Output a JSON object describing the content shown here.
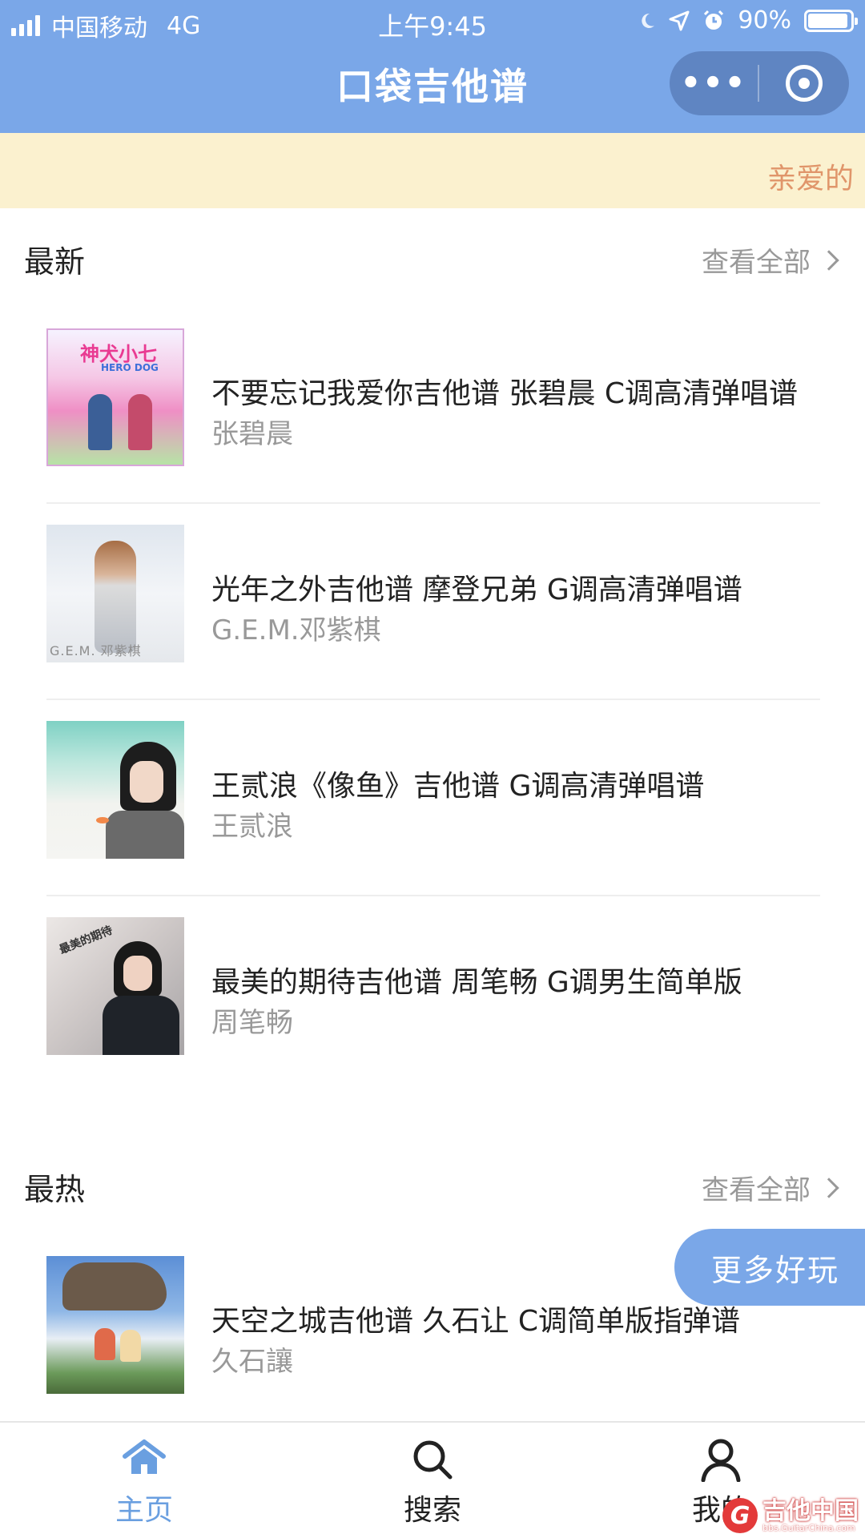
{
  "status_bar": {
    "carrier": "中国移动",
    "network": "4G",
    "time": "上午9:45",
    "battery": "90%",
    "battery_level": 0.9
  },
  "nav": {
    "title": "口袋吉他谱",
    "more_glyph": "•••"
  },
  "notice": {
    "text": "亲爱的"
  },
  "latest": {
    "title": "最新",
    "view_all": "查看全部",
    "items": [
      {
        "name": "不要忘记我爱你吉他谱 张碧晨 C调高清弹唱谱",
        "artist": "张碧晨"
      },
      {
        "name": "光年之外吉他谱 摩登兄弟 G调高清弹唱谱",
        "artist": "G.E.M.邓紫棋"
      },
      {
        "name": "王贰浪《像鱼》吉他谱 G调高清弹唱谱",
        "artist": "王贰浪"
      },
      {
        "name": "最美的期待吉他谱 周笔畅 G调男生简单版",
        "artist": "周笔畅"
      }
    ]
  },
  "hottest": {
    "title": "最热",
    "view_all": "查看全部",
    "items": [
      {
        "name": "天空之城吉他谱 久石让 C调简单版指弹谱",
        "artist": "久石讓"
      }
    ]
  },
  "covers": {
    "c1_title": "神犬小七",
    "c1_sub": "HERO DOG",
    "c2_text": "G.E.M. 邓紫棋",
    "c4_title": "最美的期待"
  },
  "float_button": {
    "label": "更多好玩"
  },
  "tabbar": {
    "tabs": [
      {
        "label": "主页"
      },
      {
        "label": "搜索"
      },
      {
        "label": "我的"
      }
    ]
  },
  "watermark": {
    "logo_letter": "G",
    "text": "吉他中国",
    "url": "bbs.GuitarChina.com"
  },
  "colors": {
    "primary": "#7aa7e8",
    "notice_bg": "#fbf1cf",
    "notice_text": "#e0956a",
    "active_tab": "#6a9fe0"
  }
}
